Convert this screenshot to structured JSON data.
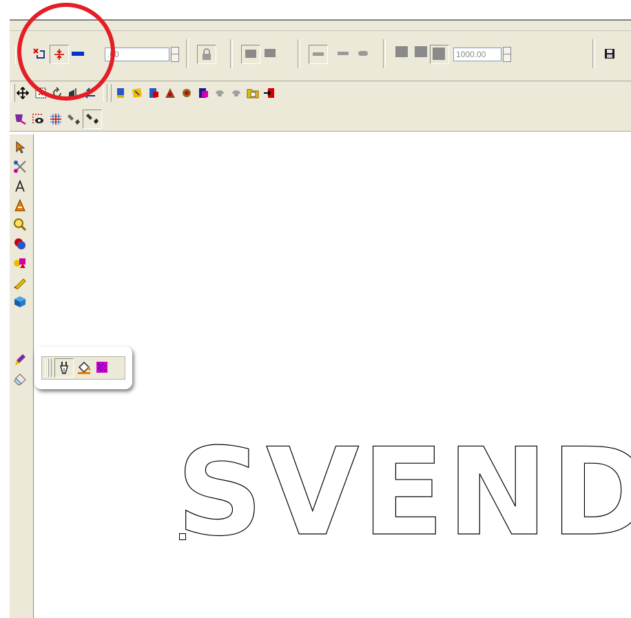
{
  "toolbar": {
    "thickness_value": ".00",
    "size_value": "1000.00"
  },
  "canvas": {
    "text": "SVEND"
  },
  "icons": {
    "row1": [
      "new-node-icon",
      "split-icon",
      "line-icon",
      "lock-icon",
      "save-icon"
    ],
    "row2": [
      "move-icon",
      "select-rect-icon",
      "rotate-icon",
      "mirror-icon",
      "flip-icon",
      "tool-blue-icon",
      "tool-yellow-icon",
      "tool-red-icon",
      "tool-mix1-icon",
      "tool-mix2-icon",
      "tool-magenta-icon",
      "tool-grey1-icon",
      "tool-grey2-icon",
      "folder-icon",
      "exit-icon"
    ],
    "row3": [
      "paint-bucket-icon",
      "dots-eye-icon",
      "grid-icon",
      "pen-tool-icon",
      "pen-selected-icon"
    ],
    "left": [
      "arrow-icon",
      "scissors-icon",
      "text-a-icon",
      "text-a-bold-icon",
      "zoom-icon",
      "shapes-icon",
      "fill-shapes-icon",
      "pencil-icon",
      "cube-icon",
      "brush-icon",
      "eraser-icon"
    ],
    "flyout": [
      "pen-nib-icon",
      "bucket-fill-icon",
      "pattern-fill-icon"
    ]
  },
  "colors": {
    "highlight": "#e41e26",
    "toolbar_bg": "#ece9d8"
  }
}
